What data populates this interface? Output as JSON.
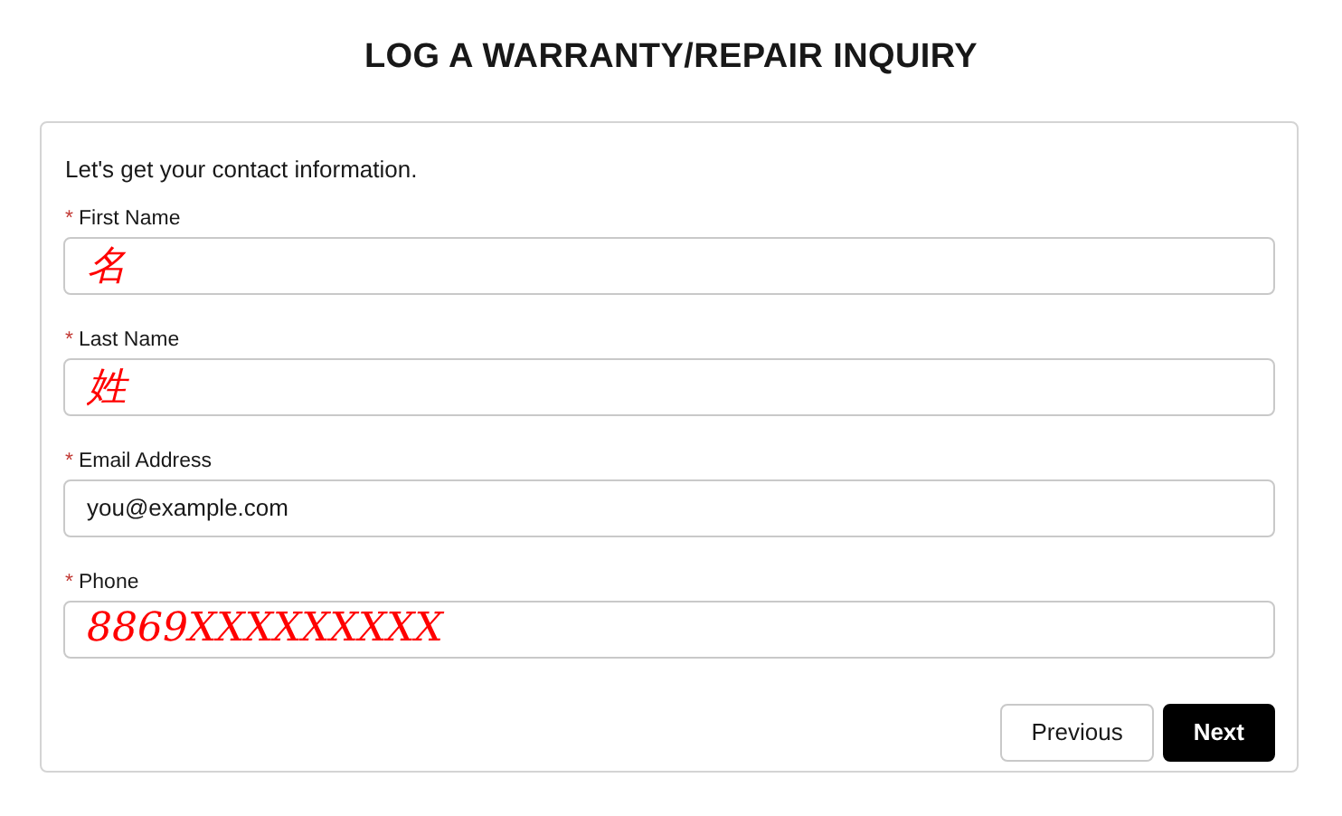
{
  "title": "LOG A WARRANTY/REPAIR INQUIRY",
  "intro": "Let's get your contact information.",
  "fields": [
    {
      "label": "First Name",
      "required": "*",
      "value": "名",
      "annotated": true
    },
    {
      "label": "Last Name",
      "required": "*",
      "value": "姓",
      "annotated": true
    },
    {
      "label": "Email Address",
      "required": "*",
      "value": "you@example.com",
      "annotated": false
    },
    {
      "label": "Phone",
      "required": "*",
      "value": "8869XXXXXXXXX",
      "annotated": true
    }
  ],
  "buttons": [
    {
      "label": "Previous",
      "kind": "secondary"
    },
    {
      "label": "Next",
      "kind": "primary"
    }
  ]
}
